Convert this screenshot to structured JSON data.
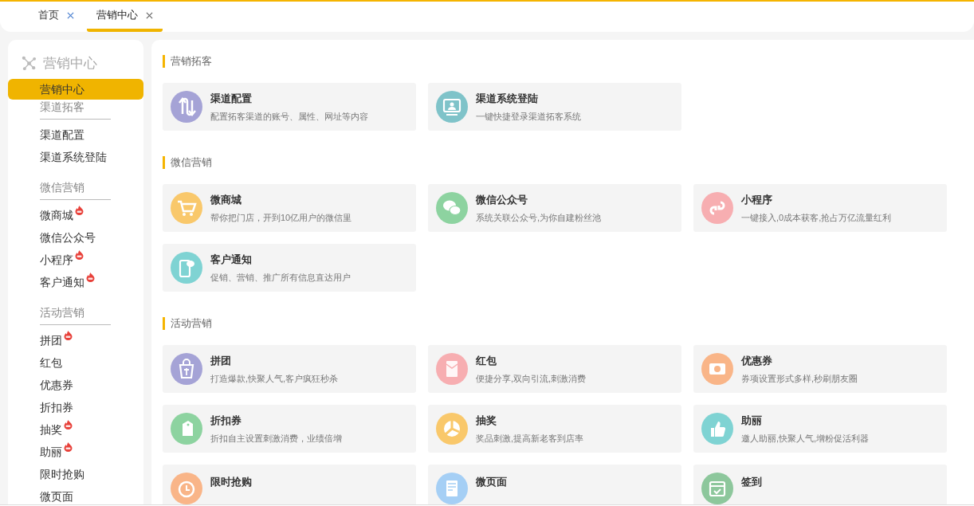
{
  "tabs": [
    {
      "label": "首页",
      "selected": false
    },
    {
      "label": "营销中心",
      "selected": true
    }
  ],
  "sidebar": {
    "title": "营销中心",
    "items": [
      {
        "label": "营销中心",
        "selected": true
      }
    ],
    "groups": [
      {
        "heading": "渠道拓客",
        "items": [
          {
            "label": "渠道配置",
            "hot": false
          },
          {
            "label": "渠道系统登陆",
            "hot": false
          }
        ]
      },
      {
        "heading": "微信营销",
        "items": [
          {
            "label": "微商城",
            "hot": true
          },
          {
            "label": "微信公众号",
            "hot": false
          },
          {
            "label": "小程序",
            "hot": true
          },
          {
            "label": "客户通知",
            "hot": true
          }
        ]
      },
      {
        "heading": "活动营销",
        "items": [
          {
            "label": "拼团",
            "hot": true
          },
          {
            "label": "红包",
            "hot": false
          },
          {
            "label": "优惠券",
            "hot": false
          },
          {
            "label": "折扣券",
            "hot": false
          },
          {
            "label": "抽奖",
            "hot": true
          },
          {
            "label": "助丽",
            "hot": true
          },
          {
            "label": "限时抢购",
            "hot": false
          },
          {
            "label": "微页面",
            "hot": false
          }
        ]
      }
    ]
  },
  "sections": [
    {
      "heading": "营销拓客",
      "cards": [
        {
          "title": "渠道配置",
          "description": "配置拓客渠道的账号、属性、网址等内容",
          "color": "#a5a3d6"
        },
        {
          "title": "渠道系统登陆",
          "description": "一键快捷登录渠道拓客系统",
          "color": "#7fc3c9"
        }
      ]
    },
    {
      "heading": "微信营销",
      "cards": [
        {
          "title": "微商城",
          "description": "帮你把门店，开到10亿用户的微信里",
          "color": "#f9c86b"
        },
        {
          "title": "微信公众号",
          "description": "系统关联公众号,为你自建粉丝池",
          "color": "#8dd3a0"
        },
        {
          "title": "小程序",
          "description": "一键接入,0成本获客,抢占万亿流量红利",
          "color": "#f7aeb1"
        },
        {
          "title": "客户通知",
          "description": "促销、营销、推广所有信息直达用户",
          "color": "#7fd3d3"
        }
      ]
    },
    {
      "heading": "活动营销",
      "cards": [
        {
          "title": "拼团",
          "description": "打造爆款,快聚人气,客户疯狂秒杀",
          "color": "#a5a3d6"
        },
        {
          "title": "红包",
          "description": "便捷分享,双向引流,刺激消费",
          "color": "#f7aeb1"
        },
        {
          "title": "优惠券",
          "description": "券项设置形式多样,秒刷朋友圈",
          "color": "#f9b588"
        },
        {
          "title": "折扣券",
          "description": "折扣自主设置刺激消费，业绩倍增",
          "color": "#8dd3a0"
        },
        {
          "title": "抽奖",
          "description": "奖品刺激,提高新老客到店率",
          "color": "#f9c86b"
        },
        {
          "title": "助丽",
          "description": "邀人助丽,快聚人气,增粉促活利器",
          "color": "#7fd3d3"
        },
        {
          "title": "限时抢购",
          "color": "#f9b588"
        },
        {
          "title": "微页面",
          "color": "#a5cff5"
        },
        {
          "title": "签到",
          "color": "#8dc79c"
        }
      ]
    }
  ]
}
